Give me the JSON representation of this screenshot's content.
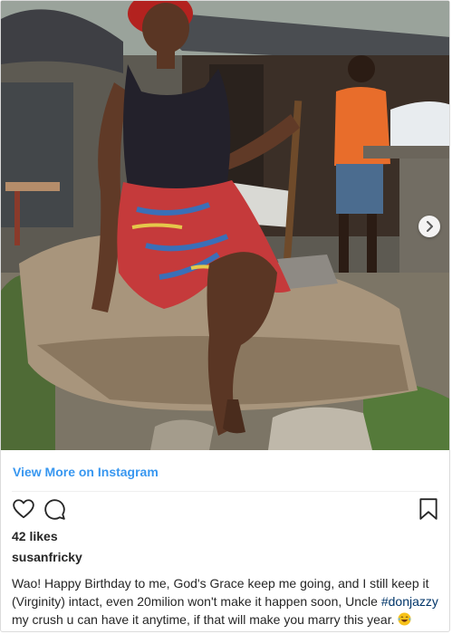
{
  "post": {
    "image_alt": "photo post",
    "view_more_label": "View More on Instagram",
    "likes_text": "42 likes",
    "username": "susanfricky",
    "caption_before": "Wao! Happy Birthday to me, God's Grace keep me going, and I still keep it (Virginity) intact, even 20milion won't make it happen soon, Uncle ",
    "caption_hashtag": "#donjazzy",
    "caption_after": " my crush u can have it anytime, if that will make you marry this year.",
    "emoji": "laughing-tears-emoji"
  },
  "icons": {
    "like": "heart-icon",
    "comment": "comment-bubble-icon",
    "save": "bookmark-icon",
    "next": "chevron-right-icon"
  },
  "colors": {
    "link_blue": "#3897f0",
    "hashtag_blue": "#003569",
    "text": "#262626",
    "border": "#dbdbdb"
  }
}
